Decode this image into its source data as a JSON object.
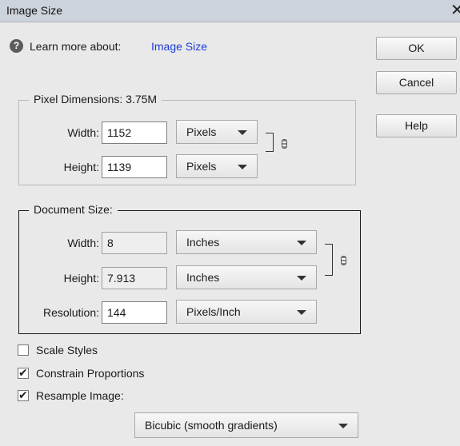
{
  "window": {
    "title": "Image Size",
    "close_glyph": "✕"
  },
  "learn_more": {
    "text": "Learn more about:",
    "link": "Image Size",
    "icon": "help-circle-icon"
  },
  "buttons": {
    "ok": "OK",
    "cancel": "Cancel",
    "help": "Help"
  },
  "pixel_dimensions": {
    "legend": "Pixel Dimensions:  3.75M",
    "width_label": "Width:",
    "width_value": "1152",
    "width_unit": "Pixels",
    "height_label": "Height:",
    "height_value": "1139",
    "height_unit": "Pixels"
  },
  "document_size": {
    "legend": "Document Size:",
    "width_label": "Width:",
    "width_value": "8",
    "width_unit": "Inches",
    "height_label": "Height:",
    "height_value": "7.913",
    "height_unit": "Inches",
    "resolution_label": "Resolution:",
    "resolution_value": "144",
    "resolution_unit": "Pixels/Inch"
  },
  "options": {
    "scale_styles": {
      "label": "Scale Styles",
      "checked": false
    },
    "constrain_proportions": {
      "label": "Constrain Proportions",
      "checked": true
    },
    "resample_image": {
      "label": "Resample Image:",
      "checked": true
    },
    "resample_method": "Bicubic (smooth gradients)"
  }
}
